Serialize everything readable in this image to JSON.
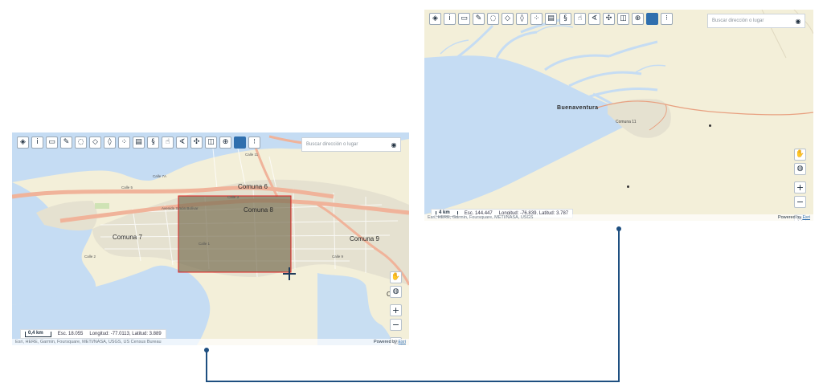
{
  "toolbar_icons": [
    "layers-icon",
    "info-icon",
    "measure-icon",
    "pencil-icon",
    "comment-icon",
    "eraser-icon",
    "tag-icon",
    "coordinates-icon",
    "print-icon",
    "route-icon",
    "hand-pointer-icon",
    "angle-tool-icon",
    "arrows-icon",
    "split-view-icon",
    "zoom-in-icon",
    "color-square-icon",
    "selection-dots-icon"
  ],
  "colors": {
    "accent": "#2f6fae",
    "water": "#c5dcf3",
    "land": "#f3efd9",
    "urban": "#e5e1d0",
    "road_major": "#f0b39a",
    "selection_fill": "#7a7154",
    "selection_border": "#e02020",
    "connector": "#1e4f80",
    "boundary": "#e8a080"
  },
  "map_a": {
    "search_placeholder": "Buscar dirección o lugar",
    "labels": {
      "comuna6": "Comuna 6",
      "comuna8": "Comuna 8",
      "comuna7": "Comuna 7",
      "comuna9": "Comuna 9",
      "comuna9_partial": "Co",
      "comuna9_partial2": "a"
    },
    "roads": {
      "calle7a": "Calle 7A",
      "calle5": "Calle 5",
      "calle11": "Calle 11",
      "avenida": "Avenida Simón Bolívar",
      "calle3": "Calle 3",
      "calle1": "Calle 1",
      "calle2": "Calle 2",
      "calle9": "Calle 9"
    },
    "scale": "0,4 km",
    "esc": "Esc. 18.055",
    "coords": "Longitud: -77.0113, Latitud: 3.889",
    "attribution": "Esri, HERE, Garmin, Foursquare, METI/NASA, USGS, US Census Bureau",
    "powered_by": "Powered by",
    "powered_link": "Esri"
  },
  "map_b": {
    "search_placeholder": "Buscar dirección o lugar",
    "labels": {
      "buenaventura": "Buenaventura",
      "comuna11": "Comuna 11"
    },
    "scale": "4 km",
    "esc": "Esc. 144.447",
    "coords": "Longitud: -76.839, Latitud: 3.787",
    "attribution": "Esri, HERE, Garmin, Foursquare, METI/NASA, USGS",
    "powered_by": "Powered by",
    "powered_link": "Esri"
  },
  "right_controls": [
    "hand-icon",
    "world-icon",
    "zoom-in-icon",
    "zoom-out-icon",
    "locate-icon"
  ]
}
